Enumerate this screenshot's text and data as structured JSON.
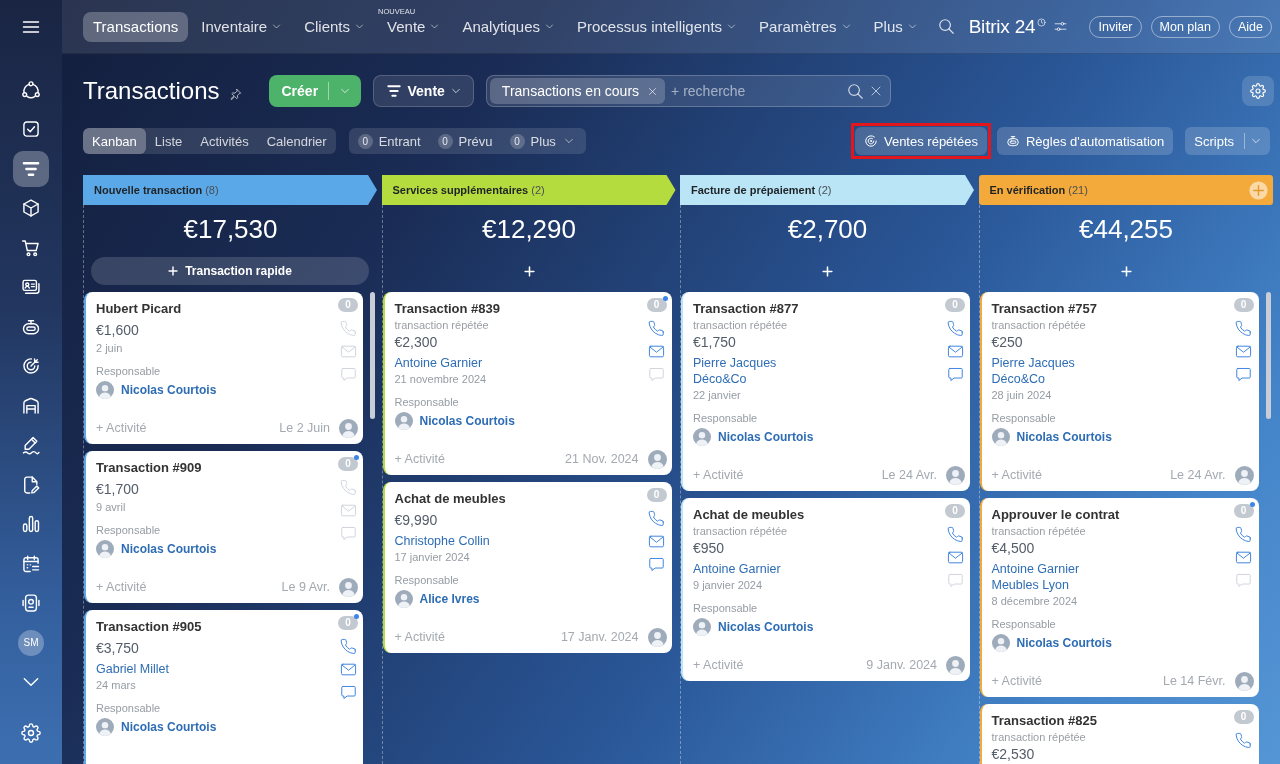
{
  "sidebar": {
    "items": [
      {
        "kind": "nodes",
        "selected": false
      },
      {
        "kind": "tasks",
        "selected": false
      },
      {
        "kind": "funnel",
        "selected": true
      },
      {
        "kind": "box",
        "selected": false
      },
      {
        "kind": "cart",
        "selected": false
      },
      {
        "kind": "contacts",
        "selected": false
      },
      {
        "kind": "robot",
        "selected": false
      },
      {
        "kind": "target",
        "selected": false
      },
      {
        "kind": "garage",
        "selected": false
      },
      {
        "kind": "sign",
        "selected": false
      },
      {
        "kind": "document",
        "selected": false
      },
      {
        "kind": "chart",
        "selected": false
      },
      {
        "kind": "calendar",
        "selected": false
      },
      {
        "kind": "device",
        "selected": false
      }
    ],
    "user_initials": "SM"
  },
  "topnav": {
    "items": [
      {
        "label": "Transactions",
        "selected": true,
        "dropdown": false
      },
      {
        "label": "Inventaire",
        "selected": false,
        "dropdown": true
      },
      {
        "label": "Clients",
        "selected": false,
        "dropdown": true
      },
      {
        "label": "Vente",
        "selected": false,
        "dropdown": true,
        "badge": "NOUVEAU"
      },
      {
        "label": "Analytiques",
        "selected": false,
        "dropdown": true
      },
      {
        "label": "Processus intelligents",
        "selected": false,
        "dropdown": true
      },
      {
        "label": "Paramètres",
        "selected": false,
        "dropdown": true
      },
      {
        "label": "Plus",
        "selected": false,
        "dropdown": true
      }
    ],
    "logo": "Bitrix 24",
    "buttons": [
      "Inviter",
      "Mon plan",
      "Aide"
    ]
  },
  "toolbar": {
    "title": "Transactions",
    "create_button": "Créer",
    "category": "Vente",
    "search": {
      "filter_tag": "Transactions en cours",
      "placeholder": "+ recherche"
    },
    "views": [
      {
        "label": "Kanban",
        "selected": true
      },
      {
        "label": "Liste",
        "selected": false
      },
      {
        "label": "Activités",
        "selected": false
      },
      {
        "label": "Calendrier",
        "selected": false
      }
    ],
    "counters": [
      {
        "count": "0",
        "label": "Entrant",
        "dropdown": false
      },
      {
        "count": "0",
        "label": "Prévu",
        "dropdown": false
      },
      {
        "count": "0",
        "label": "Plus",
        "dropdown": true
      }
    ],
    "actions": [
      {
        "kind": "repeat",
        "label": "Ventes répétées",
        "highlighted": true
      },
      {
        "kind": "robot",
        "label": "Règles d'automatisation",
        "highlighted": false
      },
      {
        "kind": "split",
        "label": "Scripts",
        "highlighted": false
      }
    ]
  },
  "columns": [
    {
      "title": "Nouvelle transaction",
      "count": "(8)",
      "color": "#5ba8e8",
      "total": "€17,530",
      "quick_add": "Transaction rapide",
      "scrollable": true,
      "cards": [
        {
          "title": "Hubert Picard",
          "amount": "€1,600",
          "date": "2 juin",
          "responsible_label": "Responsable",
          "responsible": "Nicolas Courtois",
          "counter": "0",
          "unread": false,
          "channels": [
            {
              "kind": "phone",
              "active": false
            },
            {
              "kind": "mail",
              "active": false
            },
            {
              "kind": "chat",
              "active": false
            }
          ],
          "activity": "+ Activité",
          "activity_date": "Le 2 Juin"
        },
        {
          "title": "Transaction #909",
          "amount": "€1,700",
          "date": "9 avril",
          "responsible_label": "Responsable",
          "responsible": "Nicolas Courtois",
          "counter": "0",
          "unread": true,
          "channels": [
            {
              "kind": "phone",
              "active": false
            },
            {
              "kind": "mail",
              "active": false
            },
            {
              "kind": "chat",
              "active": false
            }
          ],
          "activity": "+ Activité",
          "activity_date": "Le 9 Avr."
        },
        {
          "title": "Transaction #905",
          "amount": "€3,750",
          "contacts": [
            "Gabriel Millet"
          ],
          "date": "24 mars",
          "responsible_label": "Responsable",
          "responsible": "Nicolas Courtois",
          "counter": "0",
          "unread": true,
          "channels": [
            {
              "kind": "phone",
              "active": true
            },
            {
              "kind": "mail",
              "active": true
            },
            {
              "kind": "chat",
              "active": true
            }
          ]
        }
      ]
    },
    {
      "title": "Services supplémentaires",
      "count": "(2)",
      "color": "#b5dc3e",
      "total": "€12,290",
      "scrollable": false,
      "cards": [
        {
          "title": "Transaction #839",
          "subtitle": "transaction répétée",
          "amount": "€2,300",
          "contacts": [
            "Antoine Garnier"
          ],
          "date": "21 novembre 2024",
          "responsible_label": "Responsable",
          "responsible": "Nicolas Courtois",
          "counter": "0",
          "unread": true,
          "channels": [
            {
              "kind": "phone",
              "active": true
            },
            {
              "kind": "mail",
              "active": true
            },
            {
              "kind": "chat",
              "active": false
            }
          ],
          "activity": "+ Activité",
          "activity_date": "21 Nov. 2024"
        },
        {
          "title": "Achat de meubles",
          "amount": "€9,990",
          "contacts": [
            "Christophe Collin"
          ],
          "date": "17 janvier 2024",
          "responsible_label": "Responsable",
          "responsible": "Alice Ivres",
          "counter": "0",
          "unread": false,
          "channels": [
            {
              "kind": "phone",
              "active": true
            },
            {
              "kind": "mail",
              "active": true
            },
            {
              "kind": "chat",
              "active": true
            }
          ],
          "activity": "+ Activité",
          "activity_date": "17 Janv. 2024"
        }
      ]
    },
    {
      "title": "Facture de prépaiement",
      "count": "(2)",
      "color": "#bae5f7",
      "total": "€2,700",
      "scrollable": false,
      "cards": [
        {
          "title": "Transaction #877",
          "subtitle": "transaction répétée",
          "amount": "€1,750",
          "contacts": [
            "Pierre Jacques",
            "Déco&Co"
          ],
          "date": "22 janvier",
          "responsible_label": "Responsable",
          "responsible": "Nicolas Courtois",
          "counter": "0",
          "unread": false,
          "channels": [
            {
              "kind": "phone",
              "active": true
            },
            {
              "kind": "mail",
              "active": true
            },
            {
              "kind": "chat",
              "active": true
            }
          ],
          "activity": "+ Activité",
          "activity_date": "Le 24 Avr."
        },
        {
          "title": "Achat de meubles",
          "subtitle": "transaction répétée",
          "amount": "€950",
          "contacts": [
            "Antoine Garnier"
          ],
          "date": "9 janvier 2024",
          "responsible_label": "Responsable",
          "responsible": "Nicolas Courtois",
          "counter": "0",
          "unread": false,
          "channels": [
            {
              "kind": "phone",
              "active": true
            },
            {
              "kind": "mail",
              "active": true
            },
            {
              "kind": "chat",
              "active": false
            }
          ],
          "activity": "+ Activité",
          "activity_date": "9 Janv. 2024"
        }
      ]
    },
    {
      "title": "En vérification",
      "count": "(21)",
      "color": "#f3aa3a",
      "total": "€44,255",
      "scrollable": true,
      "cards": [
        {
          "title": "Transaction #757",
          "subtitle": "transaction répétée",
          "amount": "€250",
          "contacts": [
            "Pierre Jacques",
            "Déco&Co"
          ],
          "date": "28 juin 2024",
          "responsible_label": "Responsable",
          "responsible": "Nicolas Courtois",
          "counter": "0",
          "unread": false,
          "channels": [
            {
              "kind": "phone",
              "active": true
            },
            {
              "kind": "mail",
              "active": true
            },
            {
              "kind": "chat",
              "active": true
            }
          ],
          "activity": "+ Activité",
          "activity_date": "Le 24 Avr."
        },
        {
          "title": "Approuver le contrat",
          "subtitle": "transaction répétée",
          "amount": "€4,500",
          "contacts": [
            "Antoine Garnier",
            "Meubles Lyon"
          ],
          "date": "8 décembre 2024",
          "responsible_label": "Responsable",
          "responsible": "Nicolas Courtois",
          "counter": "0",
          "unread": true,
          "channels": [
            {
              "kind": "phone",
              "active": true
            },
            {
              "kind": "mail",
              "active": true
            },
            {
              "kind": "chat",
              "active": false
            }
          ],
          "activity": "+ Activité",
          "activity_date": "Le 14 Févr."
        },
        {
          "title": "Transaction #825",
          "subtitle": "transaction répétée",
          "amount": "€2,530",
          "counter": "0",
          "unread": false,
          "channels": [
            {
              "kind": "phone",
              "active": true
            }
          ]
        }
      ]
    }
  ]
}
